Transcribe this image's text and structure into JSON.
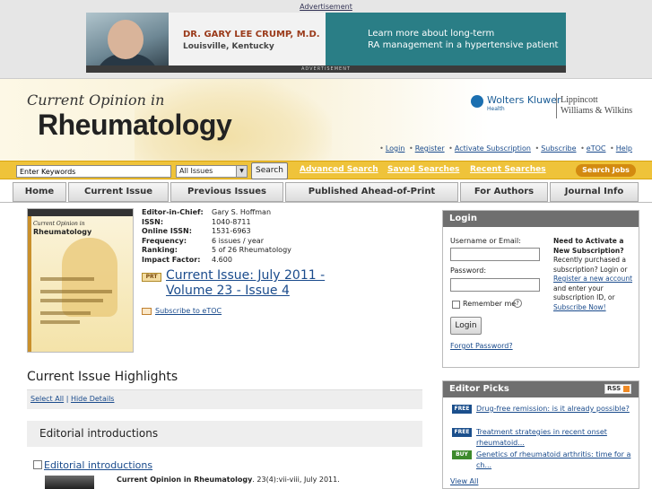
{
  "ad": {
    "label": "Advertisement",
    "doctor_name": "DR. GARY LEE CRUMP, M.D.",
    "doctor_city": "Louisville, Kentucky",
    "message_line1": "Learn more about long-term",
    "message_line2": "RA management in a hypertensive patient",
    "footer": "ADVERTISEMENT"
  },
  "header": {
    "title_prefix": "Current Opinion in",
    "title_main": "Rheumatology",
    "publisher_wk": "Wolters Kluwer",
    "publisher_wk_sub": "Health",
    "publisher_lww_line1": "Lippincott",
    "publisher_lww_line2": "Williams & Wilkins",
    "links": [
      "Login",
      "Register",
      "Activate Subscription",
      "Subscribe",
      "eTOC",
      "Help"
    ]
  },
  "search": {
    "keyword_placeholder": "Enter Keywords",
    "scope": "All Issues",
    "button": "Search",
    "links": [
      "Advanced Search",
      "Saved Searches",
      "Recent Searches"
    ],
    "jobs_button": "Search Jobs"
  },
  "nav": {
    "tabs": [
      "Home",
      "Current Issue",
      "Previous Issues",
      "Published Ahead-of-Print",
      "For Authors",
      "Journal Info"
    ]
  },
  "journal": {
    "cover_title1": "Current Opinion in",
    "cover_title2": "Rheumatology",
    "meta": [
      {
        "key": "Editor-in-Chief:",
        "value": "Gary S. Hoffman"
      },
      {
        "key": "ISSN:",
        "value": "1040-8711"
      },
      {
        "key": "Online ISSN:",
        "value": "1531-6963"
      },
      {
        "key": "Frequency:",
        "value": "6 issues / year"
      },
      {
        "key": "Ranking:",
        "value": "5 of 26 Rheumatology"
      },
      {
        "key": "Impact Factor:",
        "value": "4.600"
      }
    ],
    "prt_badge": "PRT",
    "current_issue_link": "Current Issue: July 2011 - Volume 23 - Issue 4",
    "etoc_link": "Subscribe to eTOC"
  },
  "highlights": {
    "title": "Current Issue Highlights",
    "select_all": "Select All",
    "separator": "|",
    "hide_details": "Hide Details",
    "section_title": "Editorial introductions",
    "article_title": "Editorial introductions",
    "article_journal": "Current Opinion in Rheumatology",
    "article_cite": ". 23(4):vii-viii, July 2011."
  },
  "login": {
    "title": "Login",
    "username_label": "Username or Email:",
    "password_label": "Password:",
    "remember_label": "Remember me",
    "help_glyph": "?",
    "button": "Login",
    "forgot_link": "Forgot Password?",
    "activate_heading": "Need to Activate a New Subscription?",
    "activate_text1": "Recently purchased a subscription? Login or",
    "activate_register": "Register a new account",
    "activate_text2": "and enter your subscription ID, or",
    "activate_subscribe": "Subscribe Now!"
  },
  "editor_picks": {
    "title": "Editor Picks",
    "rss_label": "RSS",
    "items": [
      {
        "badge": "FREE",
        "title": "Drug-free remission: is it already possible?"
      },
      {
        "badge": "FREE",
        "title": "Treatment strategies in recent onset rheumatoid..."
      },
      {
        "badge": "BUY",
        "title": "Genetics of rheumatoid arthritis: time for a ch..."
      }
    ],
    "view_all": "View All"
  },
  "colors": {
    "search_bar": "#efc33a",
    "link": "#1a4b8c",
    "panel_header": "#6f6f6f",
    "badge_free": "#1b4f8c",
    "badge_buy": "#3d8a2c",
    "jobs_button": "#d38a10"
  }
}
